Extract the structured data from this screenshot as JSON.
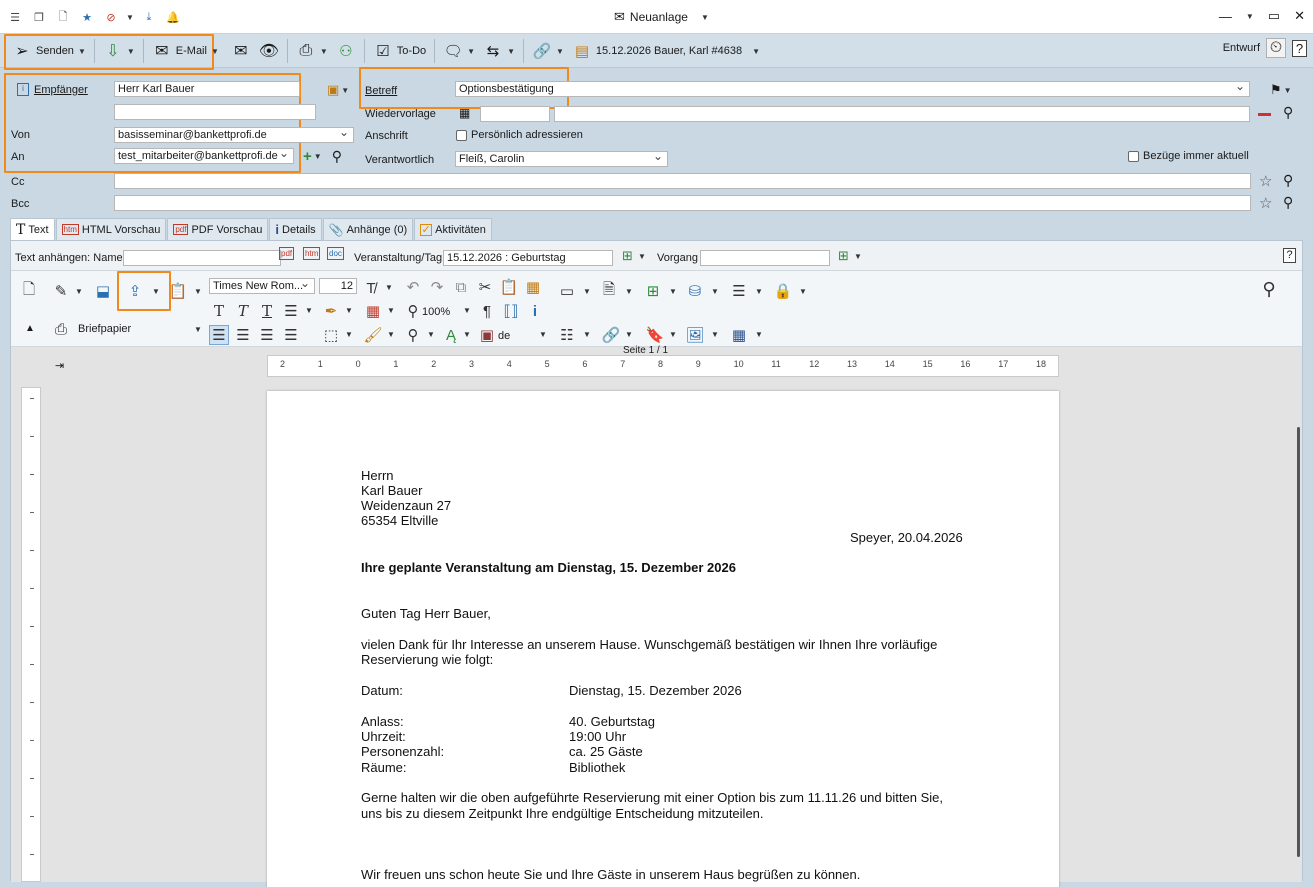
{
  "window": {
    "title": "Neuanlage"
  },
  "toolbar": {
    "senden": "Senden",
    "email": "E-Mail",
    "todo": "To-Do",
    "vorgang": "15.12.2026 Bauer, Karl #4638",
    "status": "Entwurf"
  },
  "form": {
    "empfaenger_label": "Empfänger",
    "empfaenger_value": "Herr Karl Bauer",
    "von_label": "Von",
    "von_value": "basisseminar@bankettprofi.de",
    "an_label": "An",
    "an_value": "test_mitarbeiter@bankettprofi.de",
    "cc_label": "Cc",
    "bcc_label": "Bcc",
    "betreff_label": "Betreff",
    "betreff_value": "Optionsbestätigung",
    "wiedervorlage_label": "Wiedervorlage",
    "anschrift_label": "Anschrift",
    "persoenlich_label": "Persönlich adressieren",
    "verantwortlich_label": "Verantwortlich",
    "verantwortlich_value": "Fleiß, Carolin",
    "bezuege_label": "Bezüge immer aktuell"
  },
  "tabs": [
    {
      "label": "Text"
    },
    {
      "label": "HTML Vorschau"
    },
    {
      "label": "PDF Vorschau"
    },
    {
      "label": "Details"
    },
    {
      "label": "Anhänge (0)"
    },
    {
      "label": "Aktivitäten"
    }
  ],
  "attach": {
    "name_label": "Text anhängen: Name",
    "veranstaltung_label": "Veranstaltung/Tag",
    "veranstaltung_value": "15.12.2026 : Geburtstag",
    "vorgang_label": "Vorgang"
  },
  "format": {
    "font": "Times New Rom...",
    "size": "12",
    "zoom": "100%",
    "lang": "de",
    "briefpapier": "Briefpapier"
  },
  "ruler": {
    "page_info": "Seite 1 / 1",
    "ticks": [
      "2",
      "1",
      "0",
      "1",
      "2",
      "3",
      "4",
      "5",
      "6",
      "7",
      "8",
      "9",
      "10",
      "11",
      "12",
      "13",
      "14",
      "15",
      "16",
      "17",
      "18"
    ]
  },
  "letter": {
    "addr1": "Herrn",
    "addr2": "Karl Bauer",
    "addr3": "Weidenzaun 27",
    "addr4": "65354 Eltville",
    "date": "Speyer, 20.04.2026",
    "subject": "Ihre geplante Veranstaltung am Dienstag, 15. Dezember 2026",
    "greeting": "Guten Tag Herr Bauer,",
    "intro1": "vielen Dank für Ihr Interesse an unserem Hause. Wunschgemäß bestätigen wir Ihnen Ihre vorläufige",
    "intro2": "Reservierung wie folgt:",
    "details": [
      {
        "k": "Datum:",
        "v": "Dienstag, 15. Dezember 2026"
      },
      {
        "k": "Anlass:",
        "v": "40. Geburtstag"
      },
      {
        "k": "Uhrzeit:",
        "v": "19:00 Uhr"
      },
      {
        "k": "Personenzahl:",
        "v": "ca. 25 Gäste"
      },
      {
        "k": "Räume:",
        "v": "Bibliothek"
      }
    ],
    "option1": "Gerne halten wir die oben aufgeführte Reservierung mit einer Option bis zum 11.11.26 und bitten Sie,",
    "option2": "uns bis zu diesem Zeitpunkt Ihre endgültige Entscheidung mitzuteilen.",
    "closing": "Wir freuen uns schon heute Sie und Ihre Gäste in unserem Haus begrüßen zu können."
  }
}
